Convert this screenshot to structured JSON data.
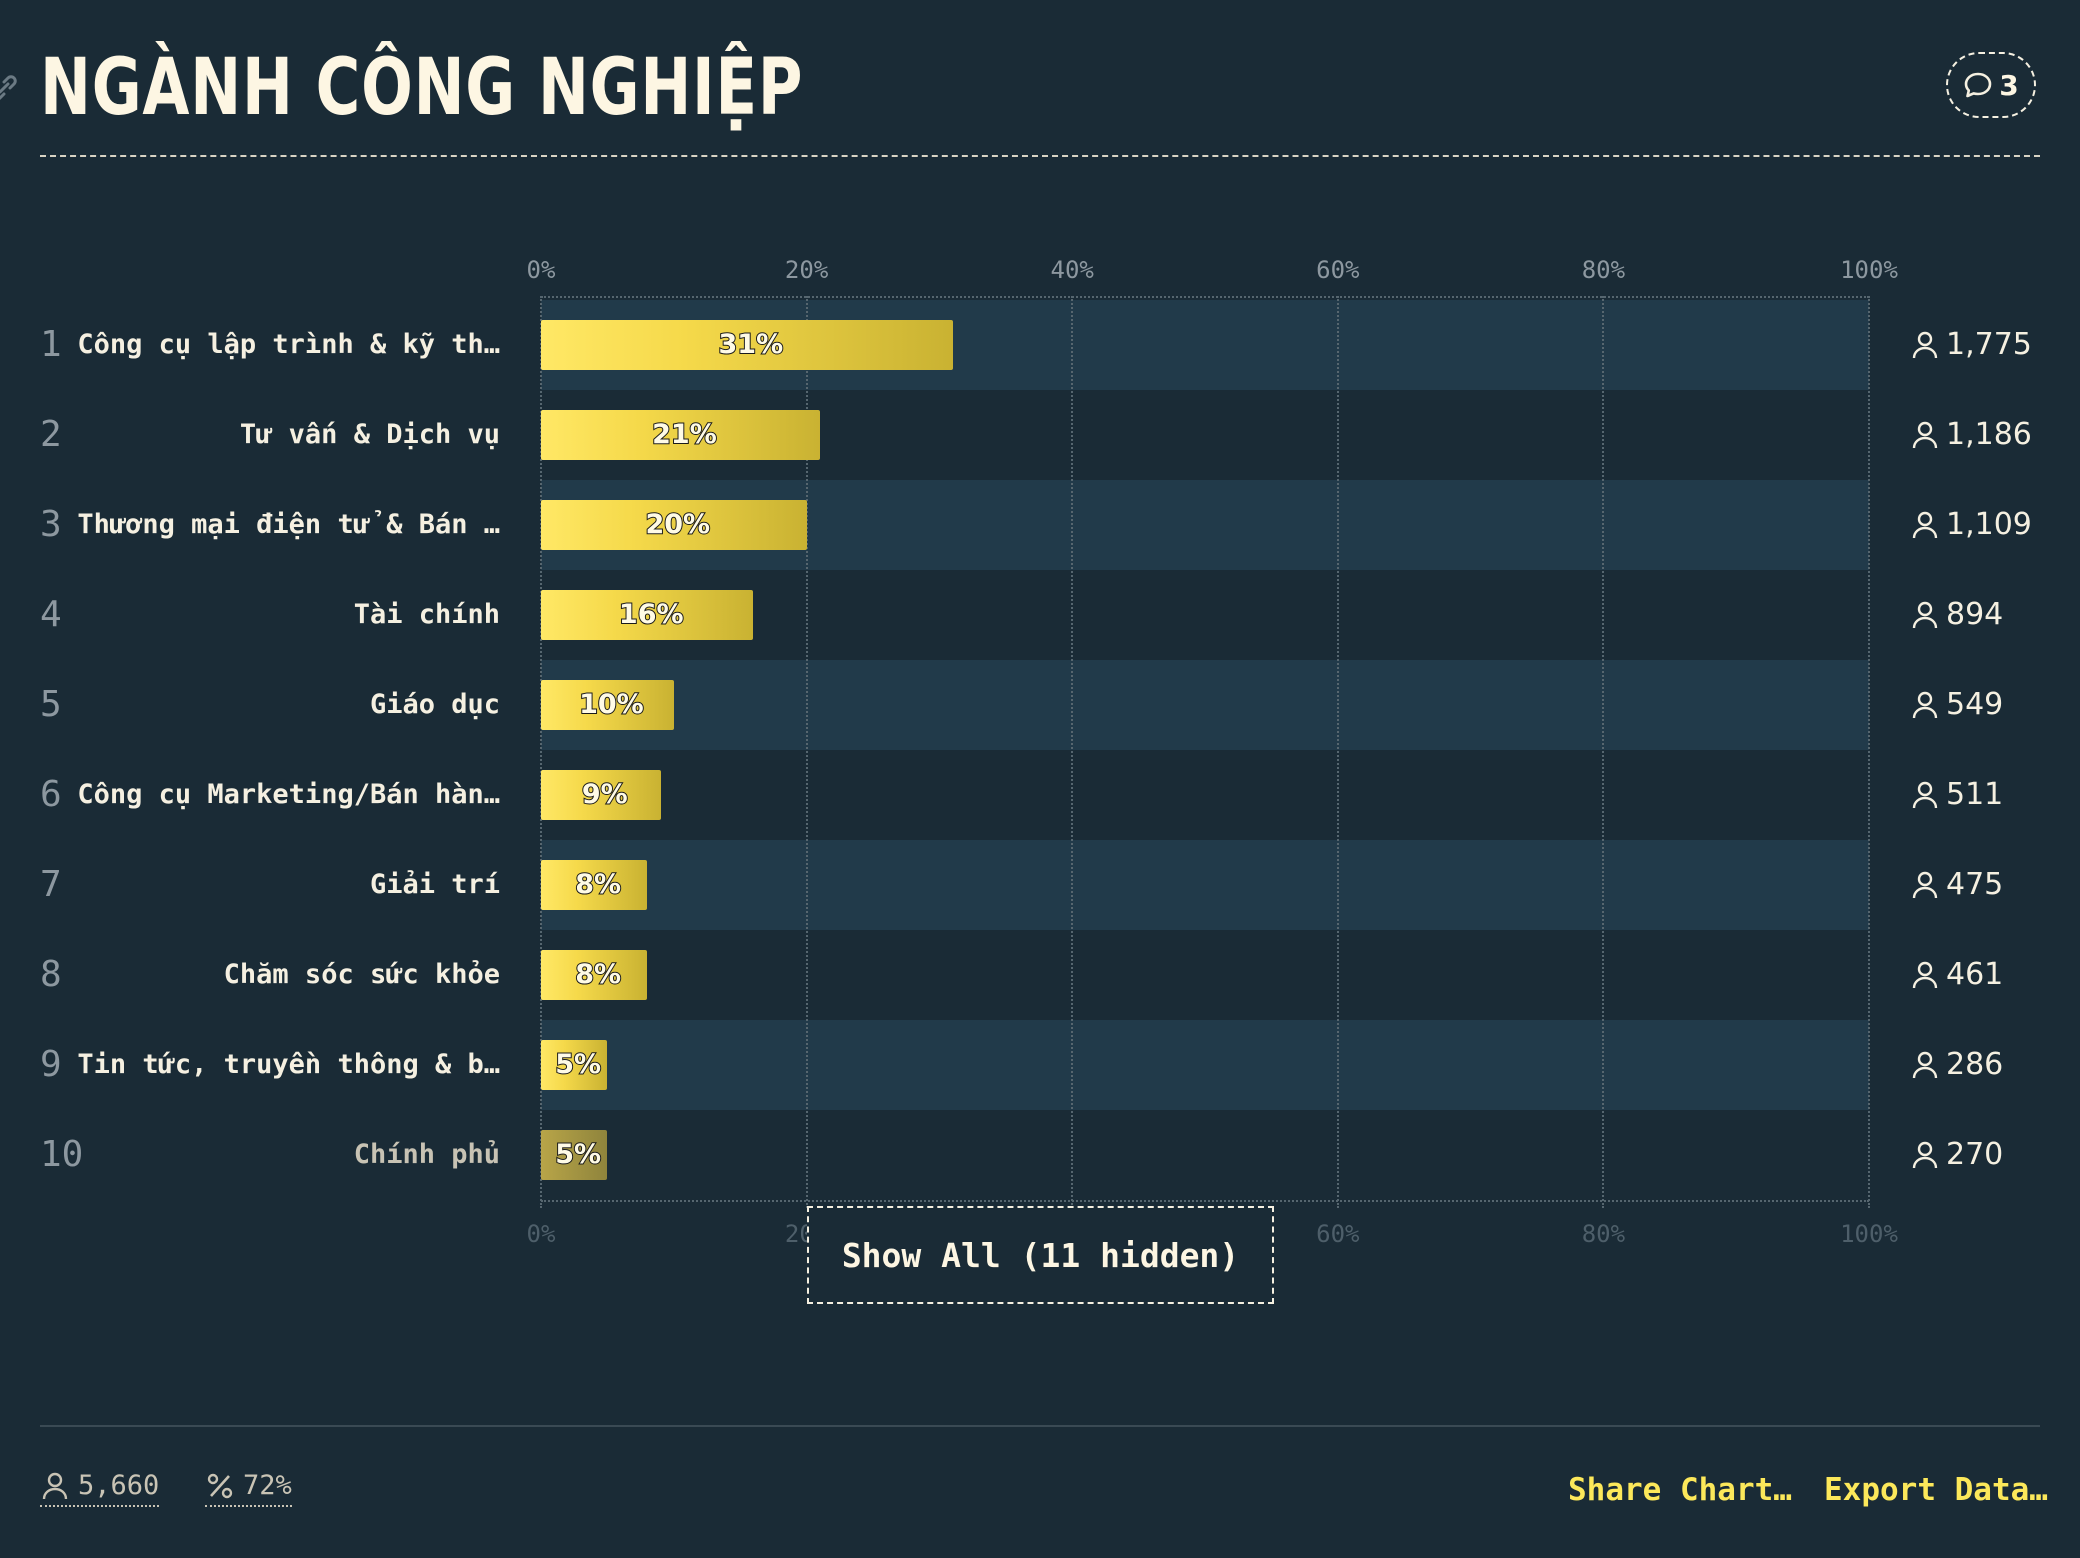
{
  "header": {
    "title": "NGÀNH CÔNG NGHIỆP",
    "comment_count": "3"
  },
  "show_all_label": "Show All (11 hidden)",
  "footer": {
    "respondents": "5,660",
    "percent": "72%",
    "share_label": "Share Chart…",
    "export_label": "Export Data…"
  },
  "colors": {
    "background": "#1a2b36",
    "bar": "#f5d94a",
    "accent": "#fce85a",
    "band": "#213a4a"
  },
  "chart_data": {
    "type": "bar",
    "orientation": "horizontal",
    "title": "NGÀNH CÔNG NGHIỆP",
    "xlim": [
      0,
      100
    ],
    "x_ticks": [
      "0%",
      "20%",
      "40%",
      "60%",
      "80%",
      "100%"
    ],
    "grid": true,
    "rows": [
      {
        "rank": "1",
        "label": "Công cụ lập trình & kỹ th…",
        "value": 31,
        "value_label": "31%",
        "count": "1,775"
      },
      {
        "rank": "2",
        "label": "Tư vấn & Dịch vụ",
        "value": 21,
        "value_label": "21%",
        "count": "1,186"
      },
      {
        "rank": "3",
        "label": "Thương mại điện tử & Bán …",
        "value": 20,
        "value_label": "20%",
        "count": "1,109"
      },
      {
        "rank": "4",
        "label": "Tài chính",
        "value": 16,
        "value_label": "16%",
        "count": "894"
      },
      {
        "rank": "5",
        "label": "Giáo dục",
        "value": 10,
        "value_label": "10%",
        "count": "549"
      },
      {
        "rank": "6",
        "label": "Công cụ Marketing/Bán hàn…",
        "value": 9,
        "value_label": "9%",
        "count": "511"
      },
      {
        "rank": "7",
        "label": "Giải trí",
        "value": 8,
        "value_label": "8%",
        "count": "475"
      },
      {
        "rank": "8",
        "label": "Chăm sóc sức khỏe",
        "value": 8,
        "value_label": "8%",
        "count": "461"
      },
      {
        "rank": "9",
        "label": "Tin tức, truyền thông & b…",
        "value": 5,
        "value_label": "5%",
        "count": "286"
      },
      {
        "rank": "10",
        "label": "Chính phủ",
        "value": 5,
        "value_label": "5%",
        "count": "270"
      }
    ]
  }
}
